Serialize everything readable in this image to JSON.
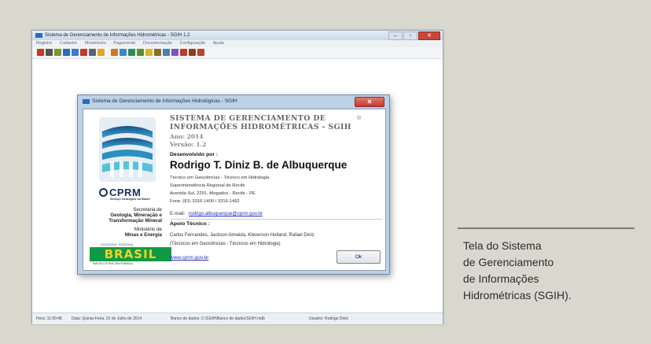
{
  "window": {
    "title": "Sistema de Gerenciamento de Informações Hidrométricas - SGIH 1.2",
    "controls": [
      "–",
      "▫",
      "✕"
    ]
  },
  "menubar": [
    "Registro",
    "Cadastro",
    "Movimento",
    "Pagamento",
    "Documentação",
    "Configuração",
    "Ajuda"
  ],
  "toolbar_icons": [
    {
      "name": "user-icon",
      "color": "#c0392b"
    },
    {
      "name": "printer-icon",
      "color": "#555555"
    },
    {
      "name": "palm-icon",
      "color": "#7a9a2a"
    },
    {
      "name": "chart-icon",
      "color": "#2b6cb5"
    },
    {
      "name": "document-icon",
      "color": "#3a7bd5"
    },
    {
      "name": "thermometer-icon",
      "color": "#c0392b"
    },
    {
      "name": "truck-icon",
      "color": "#556677"
    },
    {
      "name": "folder-icon",
      "color": "#e0a526"
    },
    {
      "name": "gauge-icon",
      "color": "#c47a2b"
    },
    {
      "name": "info-icon",
      "color": "#3a86c8"
    },
    {
      "name": "grid-icon",
      "color": "#2e8b57"
    },
    {
      "name": "calculator-icon",
      "color": "#5c8a3a"
    },
    {
      "name": "edit-icon",
      "color": "#d8b42a"
    },
    {
      "name": "report-icon",
      "color": "#8a6d2a"
    },
    {
      "name": "map-icon",
      "color": "#4a7fb8"
    },
    {
      "name": "pencil-icon",
      "color": "#7a57b8"
    },
    {
      "name": "help-icon",
      "color": "#c0392b"
    },
    {
      "name": "book-icon",
      "color": "#8e3b2a"
    },
    {
      "name": "exit-icon",
      "color": "#b8432a"
    }
  ],
  "statusbar": {
    "hora": "Hora: 11:00:48",
    "data": "Data: Quinta-Feira, 31 de Julho de 2014",
    "banco": "Banco de dados: C:\\SGIH\\Banco de dados\\SGIH.mdb",
    "usuario": "Usuário: Rodrigo Diniz"
  },
  "dialog": {
    "title": "Sistema de Gerenciamento de Informações Hidrológicas - SGIH",
    "close_label": "✕",
    "system_line1": "SISTEMA DE GERENCIAMENTO DE",
    "system_line2": "INFORMAÇÕES HIDROMÉTRICAS - SGIH",
    "copyright": "®",
    "ano": "Ano: 2014",
    "versao": "Versão: 1.2",
    "dev_label": "Desenvolvido por :",
    "dev_name": "Rodrigo T. Diniz B. de Albuquerque",
    "info_lines": [
      "Técnico em Geociências - Técnico em Hidrologia",
      "Superintendência Regional de Recife",
      "Avenida Sul, 2291, Afogados - Recife - PE",
      "Fone: (81) 3316-1400 / 3316-1492"
    ],
    "email_label": "E-mail:",
    "email": "rodrigo.albuquerque@cprm.gov.br",
    "apoio_label": "Apoio Técnico :",
    "apoio_names": "Carlos Fernandes, Jackson Almeida, Kleverson Holland, Rafael Diniz",
    "apoio_roles": "(Técnicos em Geociências - Técnicos em Hidrologia)",
    "url": "www.cprm.gov.br",
    "ok_label": "Ok",
    "logo": {
      "cprm": "CPRM",
      "cprm_sub": "Serviço Geológico do Brasil",
      "secretaria_lines": [
        "Secretaria de",
        "Geologia, Mineração e",
        "Transformação Mineral"
      ],
      "ministerio_lines": [
        "Ministério de",
        "Minas e Energia"
      ],
      "governo": "GOVERNO FEDERAL",
      "brasil": "BRASIL",
      "brasil_sub": "PAÍS RICO É PAÍS SEM POBREZA"
    }
  },
  "caption": [
    "Tela do Sistema",
    "de Gerenciamento",
    "de Informações",
    "Hidrométricas (SGIH)."
  ]
}
